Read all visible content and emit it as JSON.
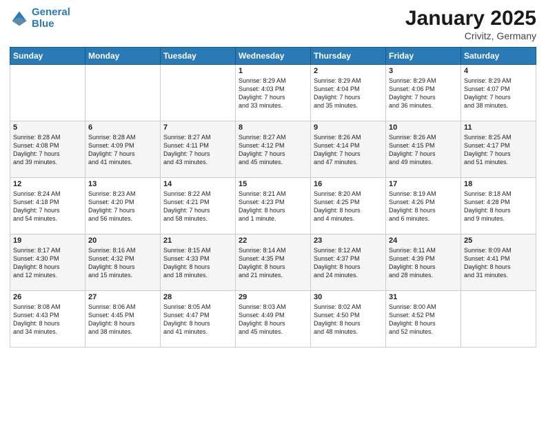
{
  "header": {
    "logo_line1": "General",
    "logo_line2": "Blue",
    "month": "January 2025",
    "location": "Crivitz, Germany"
  },
  "weekdays": [
    "Sunday",
    "Monday",
    "Tuesday",
    "Wednesday",
    "Thursday",
    "Friday",
    "Saturday"
  ],
  "weeks": [
    [
      {
        "day": "",
        "info": ""
      },
      {
        "day": "",
        "info": ""
      },
      {
        "day": "",
        "info": ""
      },
      {
        "day": "1",
        "info": "Sunrise: 8:29 AM\nSunset: 4:03 PM\nDaylight: 7 hours\nand 33 minutes."
      },
      {
        "day": "2",
        "info": "Sunrise: 8:29 AM\nSunset: 4:04 PM\nDaylight: 7 hours\nand 35 minutes."
      },
      {
        "day": "3",
        "info": "Sunrise: 8:29 AM\nSunset: 4:06 PM\nDaylight: 7 hours\nand 36 minutes."
      },
      {
        "day": "4",
        "info": "Sunrise: 8:29 AM\nSunset: 4:07 PM\nDaylight: 7 hours\nand 38 minutes."
      }
    ],
    [
      {
        "day": "5",
        "info": "Sunrise: 8:28 AM\nSunset: 4:08 PM\nDaylight: 7 hours\nand 39 minutes."
      },
      {
        "day": "6",
        "info": "Sunrise: 8:28 AM\nSunset: 4:09 PM\nDaylight: 7 hours\nand 41 minutes."
      },
      {
        "day": "7",
        "info": "Sunrise: 8:27 AM\nSunset: 4:11 PM\nDaylight: 7 hours\nand 43 minutes."
      },
      {
        "day": "8",
        "info": "Sunrise: 8:27 AM\nSunset: 4:12 PM\nDaylight: 7 hours\nand 45 minutes."
      },
      {
        "day": "9",
        "info": "Sunrise: 8:26 AM\nSunset: 4:14 PM\nDaylight: 7 hours\nand 47 minutes."
      },
      {
        "day": "10",
        "info": "Sunrise: 8:26 AM\nSunset: 4:15 PM\nDaylight: 7 hours\nand 49 minutes."
      },
      {
        "day": "11",
        "info": "Sunrise: 8:25 AM\nSunset: 4:17 PM\nDaylight: 7 hours\nand 51 minutes."
      }
    ],
    [
      {
        "day": "12",
        "info": "Sunrise: 8:24 AM\nSunset: 4:18 PM\nDaylight: 7 hours\nand 54 minutes."
      },
      {
        "day": "13",
        "info": "Sunrise: 8:23 AM\nSunset: 4:20 PM\nDaylight: 7 hours\nand 56 minutes."
      },
      {
        "day": "14",
        "info": "Sunrise: 8:22 AM\nSunset: 4:21 PM\nDaylight: 7 hours\nand 58 minutes."
      },
      {
        "day": "15",
        "info": "Sunrise: 8:21 AM\nSunset: 4:23 PM\nDaylight: 8 hours\nand 1 minute."
      },
      {
        "day": "16",
        "info": "Sunrise: 8:20 AM\nSunset: 4:25 PM\nDaylight: 8 hours\nand 4 minutes."
      },
      {
        "day": "17",
        "info": "Sunrise: 8:19 AM\nSunset: 4:26 PM\nDaylight: 8 hours\nand 6 minutes."
      },
      {
        "day": "18",
        "info": "Sunrise: 8:18 AM\nSunset: 4:28 PM\nDaylight: 8 hours\nand 9 minutes."
      }
    ],
    [
      {
        "day": "19",
        "info": "Sunrise: 8:17 AM\nSunset: 4:30 PM\nDaylight: 8 hours\nand 12 minutes."
      },
      {
        "day": "20",
        "info": "Sunrise: 8:16 AM\nSunset: 4:32 PM\nDaylight: 8 hours\nand 15 minutes."
      },
      {
        "day": "21",
        "info": "Sunrise: 8:15 AM\nSunset: 4:33 PM\nDaylight: 8 hours\nand 18 minutes."
      },
      {
        "day": "22",
        "info": "Sunrise: 8:14 AM\nSunset: 4:35 PM\nDaylight: 8 hours\nand 21 minutes."
      },
      {
        "day": "23",
        "info": "Sunrise: 8:12 AM\nSunset: 4:37 PM\nDaylight: 8 hours\nand 24 minutes."
      },
      {
        "day": "24",
        "info": "Sunrise: 8:11 AM\nSunset: 4:39 PM\nDaylight: 8 hours\nand 28 minutes."
      },
      {
        "day": "25",
        "info": "Sunrise: 8:09 AM\nSunset: 4:41 PM\nDaylight: 8 hours\nand 31 minutes."
      }
    ],
    [
      {
        "day": "26",
        "info": "Sunrise: 8:08 AM\nSunset: 4:43 PM\nDaylight: 8 hours\nand 34 minutes."
      },
      {
        "day": "27",
        "info": "Sunrise: 8:06 AM\nSunset: 4:45 PM\nDaylight: 8 hours\nand 38 minutes."
      },
      {
        "day": "28",
        "info": "Sunrise: 8:05 AM\nSunset: 4:47 PM\nDaylight: 8 hours\nand 41 minutes."
      },
      {
        "day": "29",
        "info": "Sunrise: 8:03 AM\nSunset: 4:49 PM\nDaylight: 8 hours\nand 45 minutes."
      },
      {
        "day": "30",
        "info": "Sunrise: 8:02 AM\nSunset: 4:50 PM\nDaylight: 8 hours\nand 48 minutes."
      },
      {
        "day": "31",
        "info": "Sunrise: 8:00 AM\nSunset: 4:52 PM\nDaylight: 8 hours\nand 52 minutes."
      },
      {
        "day": "",
        "info": ""
      }
    ]
  ]
}
